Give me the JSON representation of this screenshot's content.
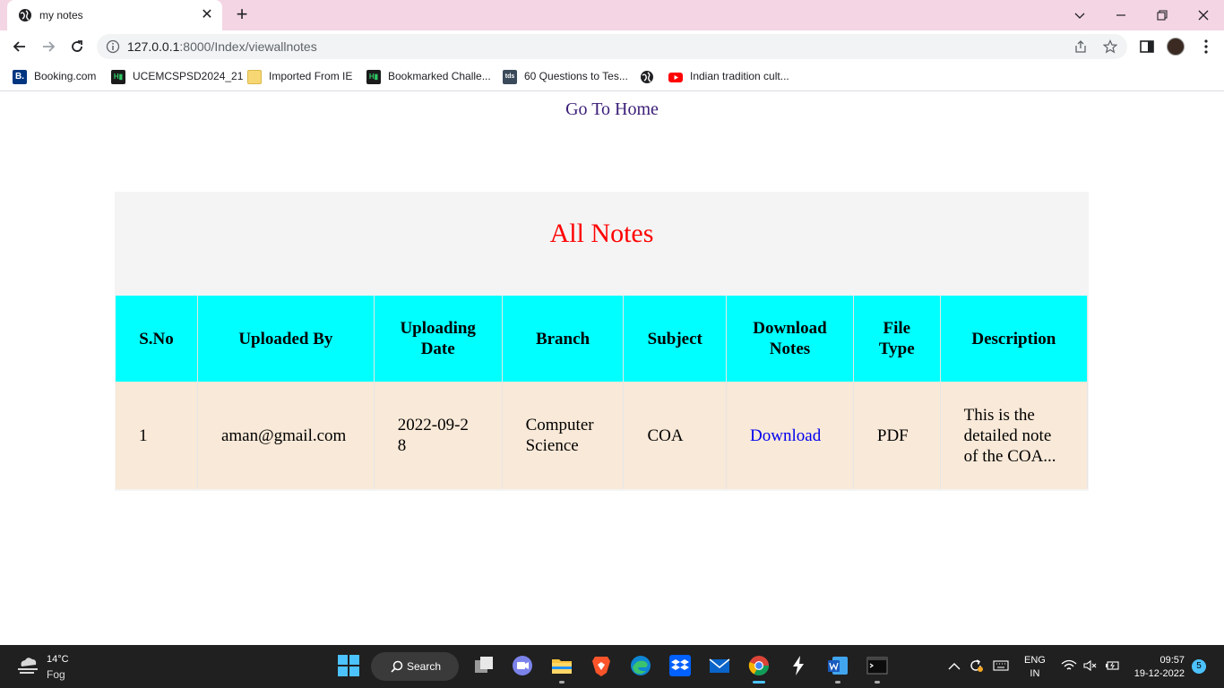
{
  "browser": {
    "tab_title": "my notes",
    "url_host": "127.0.0.1",
    "url_rest": ":8000/Index/viewallnotes",
    "bookmarks": [
      {
        "label": "Booking.com",
        "icon": "B.",
        "color": "#003580"
      },
      {
        "label": "UCEMCSPSD2024_21",
        "icon": "H",
        "color": "#1b1b1b"
      },
      {
        "label": "Imported From IE",
        "icon": "",
        "color": "#f7d774"
      },
      {
        "label": "Bookmarked Challe...",
        "icon": "H",
        "color": "#1b1b1b"
      },
      {
        "label": "60 Questions to Tes...",
        "icon": "tds",
        "color": "#3b4a5a"
      },
      {
        "label": "",
        "icon": "globe",
        "color": "#202124"
      },
      {
        "label": "Indian tradition cult...",
        "icon": "yt",
        "color": "#ff0000"
      }
    ]
  },
  "page": {
    "home_link": "Go To Home",
    "title": "All Notes",
    "columns": [
      "S.No",
      "Uploaded By",
      "Uploading Date",
      "Branch",
      "Subject",
      "Download Notes",
      "File Type",
      "Description"
    ],
    "rows": [
      {
        "sno": "1",
        "uploaded_by": "aman@gmail.com",
        "date": "2022-09-28",
        "branch": "Computer Science",
        "subject": "COA",
        "download": "Download",
        "file_type": "PDF",
        "description": "This is the detailed note of the COA..."
      }
    ]
  },
  "taskbar": {
    "temp": "14°C",
    "weather": "Fog",
    "search": "Search",
    "lang1": "ENG",
    "lang2": "IN",
    "time": "09:57",
    "date": "19-12-2022",
    "notifications": "5"
  }
}
